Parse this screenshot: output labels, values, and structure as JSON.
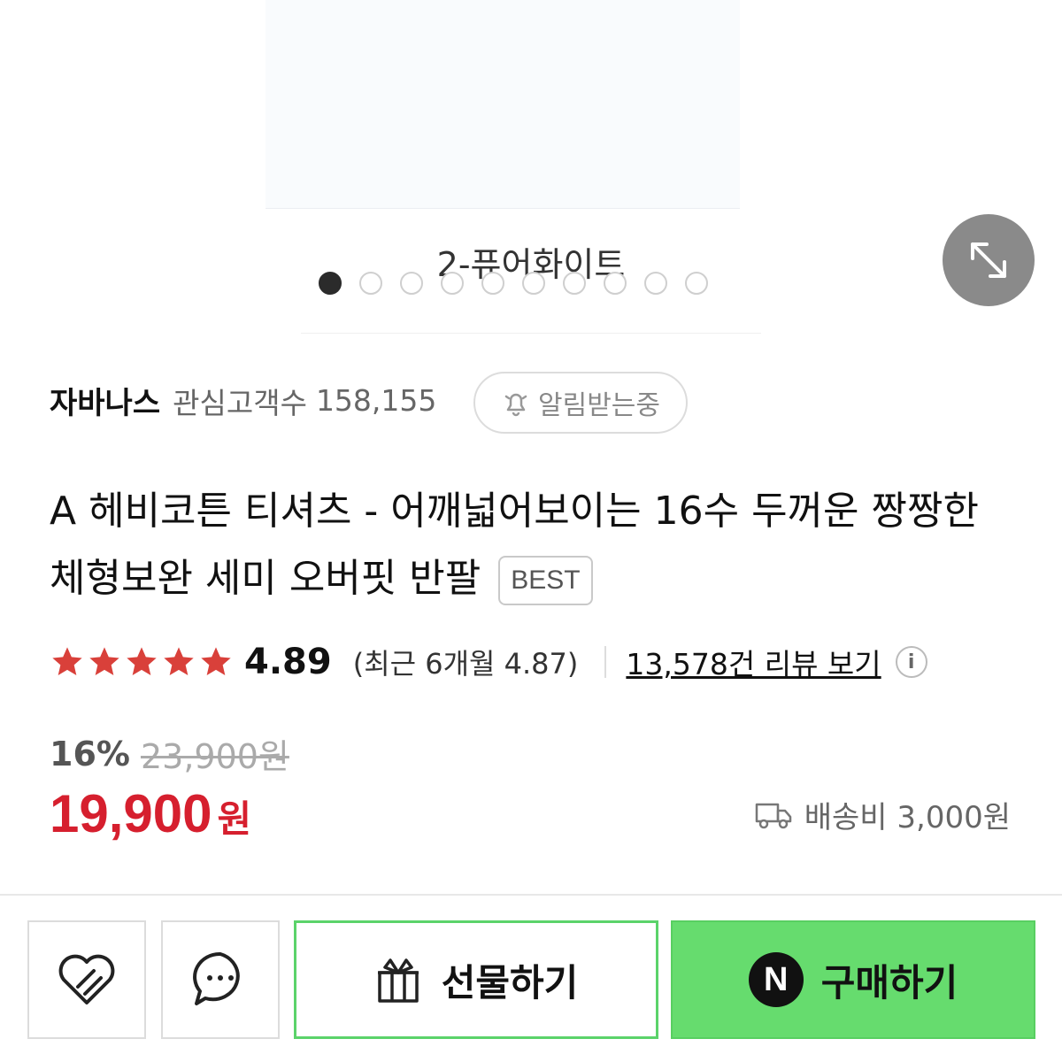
{
  "gallery": {
    "caption": "2-퓨어화이트",
    "dot_count": 10,
    "active_index": 0
  },
  "store": {
    "name": "자바나스",
    "interest_label": "관심고객수",
    "interest_count": "158,155",
    "notify_label": "알림받는중"
  },
  "product": {
    "title": "A 헤비코튼 티셔츠 - 어깨넓어보이는 16수 두꺼운 짱짱한 체형보완 세미 오버핏 반팔",
    "badge": "BEST"
  },
  "rating": {
    "stars": 5,
    "star_color": "#d9403a",
    "score": "4.89",
    "recent": "(최근 6개월 4.87)",
    "review_link": "13,578건 리뷰 보기"
  },
  "price": {
    "discount": "16%",
    "original": "23,900원",
    "sale": "19,900",
    "unit": "원",
    "sale_color": "#d61f2e",
    "shipping": "배송비 3,000원"
  },
  "actions": {
    "gift_label": "선물하기",
    "buy_label": "구매하기",
    "buy_badge": "N",
    "buy_color": "#66dc6e"
  }
}
